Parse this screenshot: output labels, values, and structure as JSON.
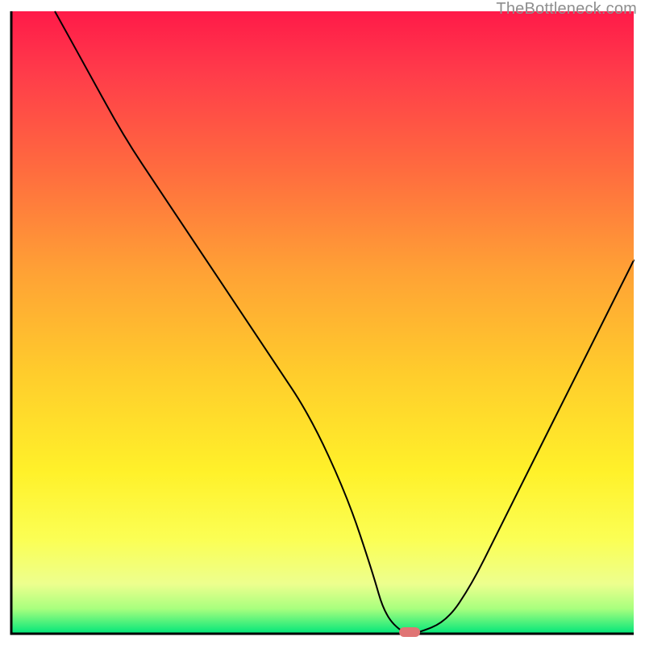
{
  "watermark": "TheBottleneck.com",
  "chart_data": {
    "type": "line",
    "title": "",
    "xlabel": "",
    "ylabel": "",
    "xlim": [
      0,
      100
    ],
    "ylim": [
      0,
      100
    ],
    "background_gradient": {
      "orientation": "vertical",
      "stops": [
        {
          "pos": 0.0,
          "color": "#ff1a49"
        },
        {
          "pos": 0.1,
          "color": "#ff3c4a"
        },
        {
          "pos": 0.25,
          "color": "#ff6a3f"
        },
        {
          "pos": 0.42,
          "color": "#ffa235"
        },
        {
          "pos": 0.58,
          "color": "#ffcc2c"
        },
        {
          "pos": 0.74,
          "color": "#fff12a"
        },
        {
          "pos": 0.85,
          "color": "#fbff55"
        },
        {
          "pos": 0.92,
          "color": "#edff8e"
        },
        {
          "pos": 0.96,
          "color": "#a8ff7e"
        },
        {
          "pos": 1.0,
          "color": "#00e67a"
        }
      ]
    },
    "series": [
      {
        "name": "curve",
        "x": [
          7,
          12,
          18,
          24,
          30,
          36,
          42,
          48,
          54,
          58,
          60,
          63,
          65,
          70,
          74,
          78,
          84,
          90,
          96,
          100
        ],
        "y": [
          100,
          91,
          80,
          71,
          62,
          53,
          44,
          35,
          22,
          10,
          3,
          0,
          0,
          2,
          8,
          16,
          28,
          40,
          52,
          60
        ]
      }
    ],
    "marker": {
      "x": 64,
      "y": 0,
      "shape": "rounded-rect",
      "color": "#e07474"
    },
    "axes": {
      "left": true,
      "bottom": true,
      "right": false,
      "top": false
    }
  }
}
